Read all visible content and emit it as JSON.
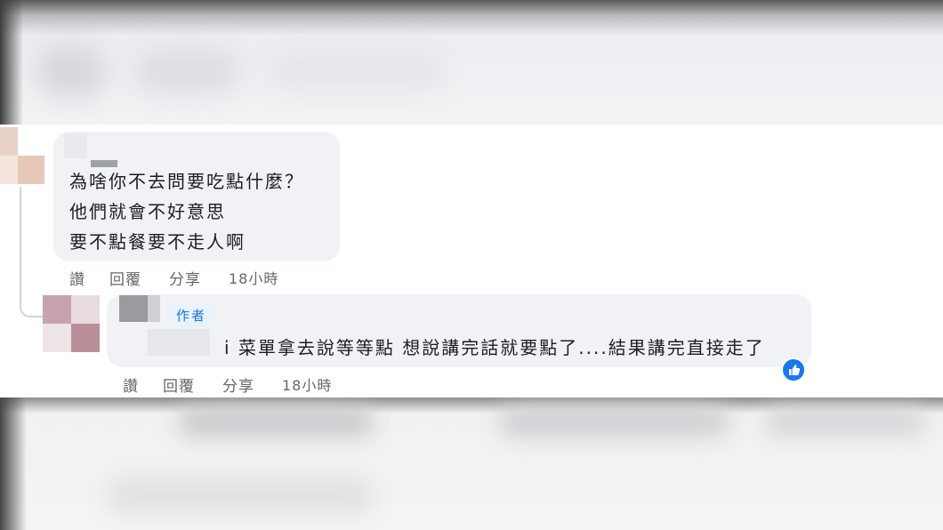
{
  "comment": {
    "lines": [
      "為啥你不去問要吃點什麼？",
      "他們就會不好意思",
      "要不點餐要不走人啊"
    ],
    "actions": {
      "like": "讚",
      "reply": "回覆",
      "share": "分享",
      "time": "18小時"
    }
  },
  "reply": {
    "badge": "作者",
    "text": "i 菜單拿去說等等點 想說講完話就要點了....結果講完直接走了",
    "actions": {
      "like": "讚",
      "reply": "回覆",
      "share": "分享",
      "time": "18小時"
    },
    "reaction_icon": "like-icon",
    "colors": {
      "reaction": "#1877f2",
      "badge_text": "#1b74e4"
    }
  }
}
